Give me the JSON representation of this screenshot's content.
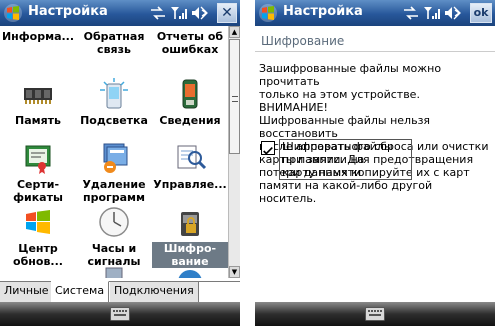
{
  "left_screen": {
    "title": "Настройка",
    "close_label": "✕",
    "tiles": [
      {
        "row": 0,
        "label": "Информа...",
        "icon": "info-icon"
      },
      {
        "row": 0,
        "label": "Обратная связь",
        "icon": "feedback-icon"
      },
      {
        "row": 0,
        "label": "Отчеты об ошибках",
        "icon": "error-report-icon"
      },
      {
        "row": 1,
        "label": "Память",
        "icon": "memory-icon"
      },
      {
        "row": 1,
        "label": "Подсветка",
        "icon": "backlight-icon"
      },
      {
        "row": 1,
        "label": "Сведения",
        "icon": "about-icon"
      },
      {
        "row": 2,
        "label": "Серти-фикаты",
        "icon": "certificates-icon"
      },
      {
        "row": 2,
        "label": "Удаление программ",
        "icon": "remove-programs-icon"
      },
      {
        "row": 2,
        "label": "Управляе...",
        "icon": "managed-programs-icon"
      },
      {
        "row": 3,
        "label": "Центр обнов...",
        "icon": "update-center-icon"
      },
      {
        "row": 3,
        "label": "Часы и сигналы",
        "icon": "clock-alarms-icon"
      },
      {
        "row": 3,
        "label": "Шифро-вание",
        "icon": "encryption-icon",
        "selected": true
      }
    ],
    "tabs": [
      "Личные",
      "Система",
      "Подключения"
    ],
    "active_tab": "Система"
  },
  "right_screen": {
    "title": "Настройка",
    "ok_label": "ok",
    "header": "Шифрование",
    "body_lines": [
      "Зашифрованные файлы можно прочитать",
      "только на этом устройстве. ВНИМАНИЕ!",
      "Шифрованные файлы нельзя восстановить",
      "после аппаратного сброса или очистки",
      "карты памяти. Для предотвращения",
      "потери данных копируйте их с карт",
      "памяти на какой-либо другой носитель."
    ],
    "checkbox_lines": [
      "Шифровать файлы при записи на",
      "карту памяти"
    ],
    "checkbox_checked": true
  },
  "colors": {
    "titlebar": "#27579a",
    "selection": "#6d7a86",
    "bottom_bar": "#2e2e2e"
  }
}
